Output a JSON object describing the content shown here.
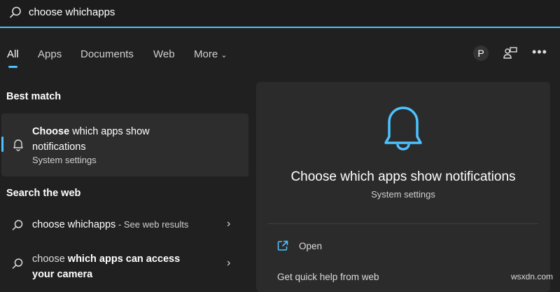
{
  "search": {
    "query": "choose whichapps"
  },
  "tabs": [
    {
      "label": "All"
    },
    {
      "label": "Apps"
    },
    {
      "label": "Documents"
    },
    {
      "label": "Web"
    },
    {
      "label": "More"
    }
  ],
  "toolbar": {
    "avatar_letter": "P"
  },
  "best_match": {
    "heading": "Best match",
    "title_bold": "Choose",
    "title_rest": " which apps show",
    "title_line2": "notifications",
    "subtitle": "System settings"
  },
  "web": {
    "heading": "Search the web",
    "items": [
      {
        "normal": "choose whichapps",
        "suffix": " - See web results"
      },
      {
        "normal": "choose ",
        "bold": "which apps can access",
        "line2": "your camera"
      }
    ]
  },
  "preview": {
    "title": "Choose which apps show notifications",
    "subtitle": "System settings",
    "actions": [
      {
        "label": "Open"
      },
      {
        "label": "Get quick help from web"
      }
    ]
  },
  "watermark": "wsxdn.com",
  "colors": {
    "accent": "#4cc2ff",
    "background": "#202020",
    "panel": "#2b2b2b"
  }
}
